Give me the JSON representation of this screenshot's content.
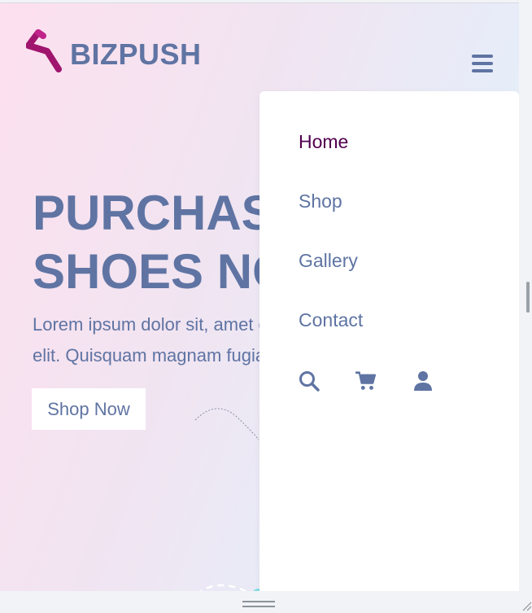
{
  "brand": {
    "logo_text": "BIZPUSH",
    "logo_icon": "lightning-bolt-icon",
    "logo_color": "#a0156e"
  },
  "hero": {
    "title_line1": "PURCHASE",
    "title_line2": "SHOES NOW",
    "text_line1": "Lorem ipsum dolor sit, amet consectetur adipisicing",
    "text_line2": "elit. Quisquam magnam fugiat",
    "cta_label": "Shop Now"
  },
  "menu": {
    "items": [
      {
        "label": "Home",
        "active": true
      },
      {
        "label": "Shop",
        "active": false
      },
      {
        "label": "Gallery",
        "active": false
      },
      {
        "label": "Contact",
        "active": false
      }
    ],
    "icons": [
      "search-icon",
      "cart-icon",
      "user-icon"
    ],
    "toggle_icon": "hamburger-icon"
  },
  "colors": {
    "primary_text": "#5f74a3",
    "active_link": "#52004f",
    "panel_bg": "#ffffff"
  }
}
